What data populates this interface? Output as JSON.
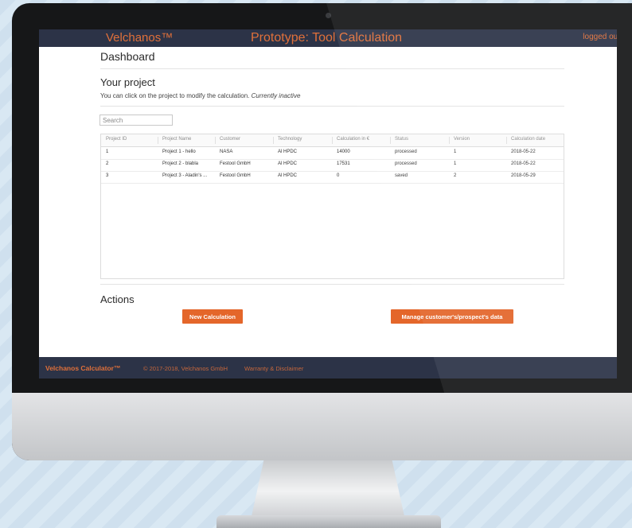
{
  "header": {
    "brand": "Velchanos™",
    "title": "Prototype: Tool Calculation",
    "login_status": "logged out"
  },
  "page_title": "Dashboard",
  "project_section": {
    "title": "Your project",
    "hint": "You can click on the project to modify the calculation.",
    "hint_status": "Currently inactive"
  },
  "search": {
    "placeholder": "Search"
  },
  "table": {
    "columns": [
      "Project ID",
      "Project Name",
      "Customer",
      "Technology",
      "Calculation in €",
      "Status",
      "Version",
      "Calculation date"
    ],
    "rows": [
      [
        "1",
        "Project 1 - hello",
        "NASA",
        "Al HPDC",
        "14000",
        "processed",
        "1",
        "2018-05-22"
      ],
      [
        "2",
        "Project 2 - blabla",
        "Festool GmbH",
        "Al HPDC",
        "17531",
        "processed",
        "1",
        "2018-05-22"
      ],
      [
        "3",
        "Project 3 - Aladin's ...",
        "Festool GmbH",
        "Al HPDC",
        "0",
        "saved",
        "2",
        "2018-05-29"
      ]
    ]
  },
  "actions": {
    "title": "Actions",
    "new_calculation": "New Calculation",
    "manage_data": "Manage customer's/prospect's data"
  },
  "footer": {
    "brand": "Velchanos Calculator™",
    "copyright": "© 2017-2018, Velchanos GmbH",
    "warranty_link": "Warranty & Disclaimer"
  },
  "colors": {
    "accent": "#e4662a",
    "header_bg": "#2c3347",
    "brand_text": "#e0703a"
  }
}
